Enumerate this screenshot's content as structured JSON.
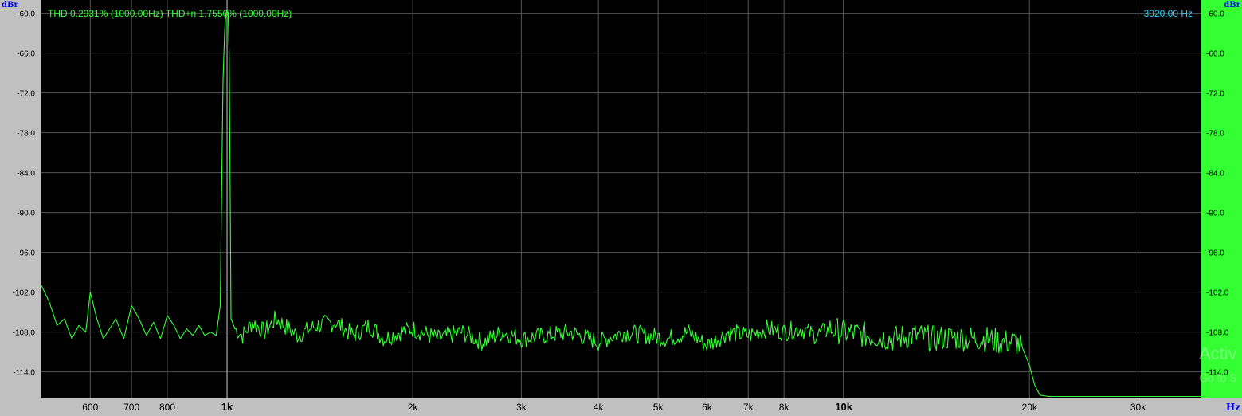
{
  "readouts": {
    "thd": "THD 0.2931% (1000.00Hz) THD+n 1.7550% (1000.00Hz)",
    "cursor": "3020.00 Hz",
    "watermark_line1": "Activ",
    "watermark_line2": "Go to S"
  },
  "colors": {
    "trace": "#33ff33",
    "plot_bg": "#000000",
    "grid": "#555555",
    "left_axis_bg": "#c0c0c0",
    "right_axis_bg": "#33ff33",
    "unit_text": "#0000ee",
    "cursor_text": "#33ccff"
  },
  "chart_data": {
    "type": "line",
    "title": "",
    "xlabel": "Hz",
    "ylabel": "dBr",
    "xscale": "log",
    "xlim": [
      500,
      38000
    ],
    "ylim": [
      -118,
      -58
    ],
    "grid": true,
    "x_ticks": [
      {
        "value": 600,
        "label": "600",
        "bold": false
      },
      {
        "value": 700,
        "label": "700",
        "bold": false
      },
      {
        "value": 800,
        "label": "800",
        "bold": false
      },
      {
        "value": 1000,
        "label": "1k",
        "bold": true
      },
      {
        "value": 2000,
        "label": "2k",
        "bold": false
      },
      {
        "value": 3000,
        "label": "3k",
        "bold": false
      },
      {
        "value": 4000,
        "label": "4k",
        "bold": false
      },
      {
        "value": 5000,
        "label": "5k",
        "bold": false
      },
      {
        "value": 6000,
        "label": "6k",
        "bold": false
      },
      {
        "value": 7000,
        "label": "7k",
        "bold": false
      },
      {
        "value": 8000,
        "label": "8k",
        "bold": false
      },
      {
        "value": 10000,
        "label": "10k",
        "bold": true
      },
      {
        "value": 20000,
        "label": "20k",
        "bold": false
      },
      {
        "value": 30000,
        "label": "30k",
        "bold": false
      }
    ],
    "y_ticks": [
      {
        "value": -60,
        "label": "-60.0"
      },
      {
        "value": -66,
        "label": "-66.0"
      },
      {
        "value": -72,
        "label": "-72.0"
      },
      {
        "value": -78,
        "label": "-78.0"
      },
      {
        "value": -84,
        "label": "-84.0"
      },
      {
        "value": -90,
        "label": "-90.0"
      },
      {
        "value": -96,
        "label": "-96.0"
      },
      {
        "value": -102,
        "label": "-102.0"
      },
      {
        "value": -108,
        "label": "-108.0"
      },
      {
        "value": -114,
        "label": "-114.0"
      }
    ],
    "series": [
      {
        "color": "#33ff33",
        "x": [
          500,
          515,
          530,
          545,
          560,
          575,
          590,
          600,
          615,
          630,
          645,
          660,
          680,
          700,
          720,
          740,
          760,
          780,
          800,
          820,
          840,
          860,
          880,
          900,
          920,
          940,
          960,
          975,
          985,
          992,
          996,
          1000,
          1004,
          1008,
          1015,
          1030,
          1060,
          1100,
          1150,
          1200,
          1300,
          1400,
          1500,
          1600,
          1700,
          1800,
          1900,
          2000,
          2200,
          2400,
          2600,
          2800,
          3000,
          3300,
          3600,
          4000,
          4400,
          4800,
          5200,
          5600,
          6000,
          6500,
          7000,
          7500,
          8000,
          8500,
          9000,
          9500,
          10000,
          11000,
          12000,
          13000,
          14000,
          15000,
          16000,
          17000,
          18000,
          19000,
          19500,
          20000,
          20400,
          20800,
          21500,
          25000,
          30000,
          38000
        ],
        "y": [
          -101,
          -103.5,
          -107,
          -106,
          -109,
          -107,
          -108,
          -102,
          -106,
          -109,
          -107.5,
          -106,
          -109,
          -104,
          -106,
          -108.5,
          -106.5,
          -109,
          -105.5,
          -107,
          -109,
          -107.5,
          -108.5,
          -107,
          -108.5,
          -108,
          -108.5,
          -104,
          -70,
          -62,
          -60,
          -59.5,
          -60,
          -66,
          -106,
          -107.5,
          -108.5,
          -106.5,
          -108,
          -106,
          -108.5,
          -107,
          -106.5,
          -108.5,
          -107,
          -109,
          -108,
          -107.5,
          -109,
          -108,
          -109.5,
          -108,
          -109,
          -108.5,
          -108,
          -109.5,
          -108,
          -108.5,
          -109,
          -108,
          -110,
          -108,
          -108.5,
          -107.5,
          -108,
          -107.5,
          -108.5,
          -107.5,
          -108,
          -108.5,
          -109,
          -108.5,
          -109,
          -108.8,
          -109,
          -109,
          -109.5,
          -109.5,
          -110.5,
          -113,
          -116,
          -117.5,
          -117.7,
          -117.7,
          -117.7,
          -117.7
        ]
      }
    ]
  }
}
